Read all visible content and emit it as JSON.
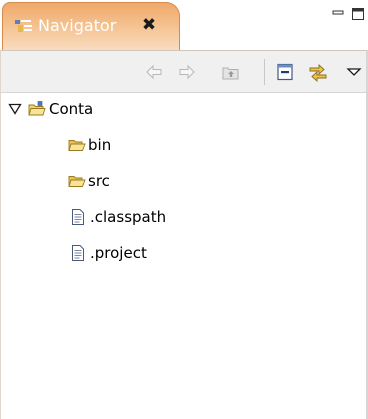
{
  "view": {
    "title": "Navigator",
    "close_glyph": "✖",
    "accent_color": "#efa86b"
  },
  "window_controls": {
    "minimize_icon": "minimize-icon",
    "maximize_icon": "maximize-icon"
  },
  "toolbar": {
    "buttons": [
      {
        "name": "back-button",
        "icon": "arrow-left-icon",
        "enabled": false
      },
      {
        "name": "forward-button",
        "icon": "arrow-right-icon",
        "enabled": false
      },
      {
        "name": "up-button",
        "icon": "up-folder-icon",
        "enabled": false
      },
      {
        "name": "collapse-all-button",
        "icon": "collapse-all-icon",
        "enabled": true
      },
      {
        "name": "link-with-editor-button",
        "icon": "link-editor-icon",
        "enabled": true
      },
      {
        "name": "view-menu-button",
        "icon": "chevron-down-icon",
        "enabled": true
      }
    ]
  },
  "tree": {
    "project": {
      "label": "Conta",
      "expanded": true,
      "icon": "project-folder-icon"
    },
    "children": [
      {
        "label": "bin",
        "icon": "folder-icon"
      },
      {
        "label": "src",
        "icon": "folder-icon"
      },
      {
        "label": ".classpath",
        "icon": "file-icon"
      },
      {
        "label": ".project",
        "icon": "file-icon"
      }
    ]
  }
}
